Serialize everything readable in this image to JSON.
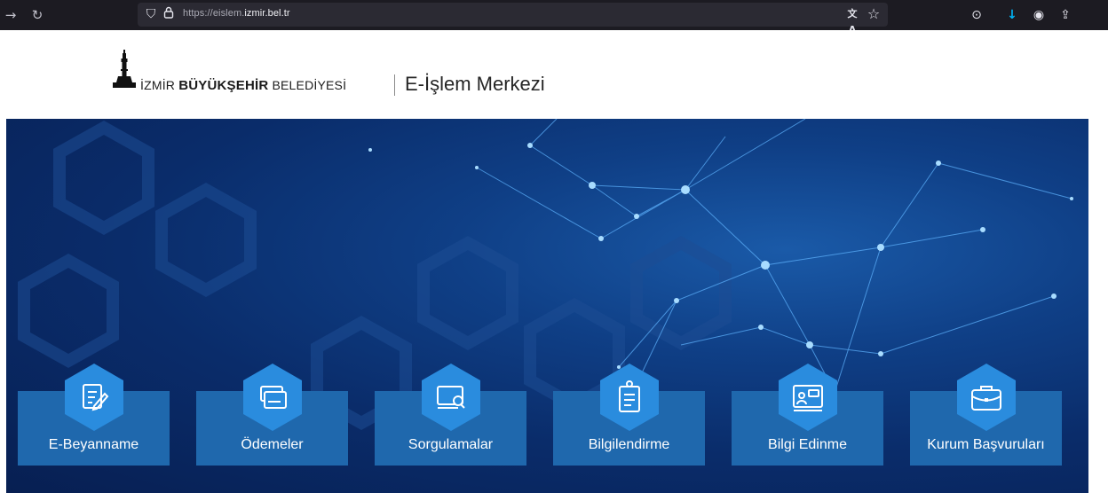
{
  "browser": {
    "url_prefix": "https://eislem.",
    "url_domain": "izmir.bel.tr",
    "icons": [
      "back-icon",
      "reload-icon",
      "shield-icon",
      "lock-icon",
      "translate-icon",
      "star-icon",
      "pocket-icon",
      "download-icon",
      "account-icon",
      "extensions-icon"
    ],
    "glyphs": {
      "back": "→",
      "reload": "↻",
      "shield": "⛉",
      "lock": "🔒",
      "translate": "文A",
      "star": "☆",
      "pocket": "⊙",
      "download": "↓",
      "account": "◉",
      "extensions": "⇪"
    }
  },
  "header": {
    "org_pre": "İZMİR",
    "org_bold": "BÜYÜKŞEHİR",
    "org_post": "BELEDİYESİ",
    "subtitle": "E-İşlem Merkezi"
  },
  "services": [
    {
      "label": "E-Beyanname",
      "icon": "document-edit-icon"
    },
    {
      "label": "Ödemeler",
      "icon": "card-icon"
    },
    {
      "label": "Sorgulamalar",
      "icon": "monitor-search-icon"
    },
    {
      "label": "Bilgilendirme",
      "icon": "clipboard-icon"
    },
    {
      "label": "Bilgi Edinme",
      "icon": "presentation-icon"
    },
    {
      "label": "Kurum Başvuruları",
      "icon": "briefcase-icon"
    }
  ],
  "colors": {
    "card": "#1f68ad",
    "hex": "#2a8cde",
    "browser_bg": "#1c1b22",
    "download_accent": "#00b3f4"
  }
}
